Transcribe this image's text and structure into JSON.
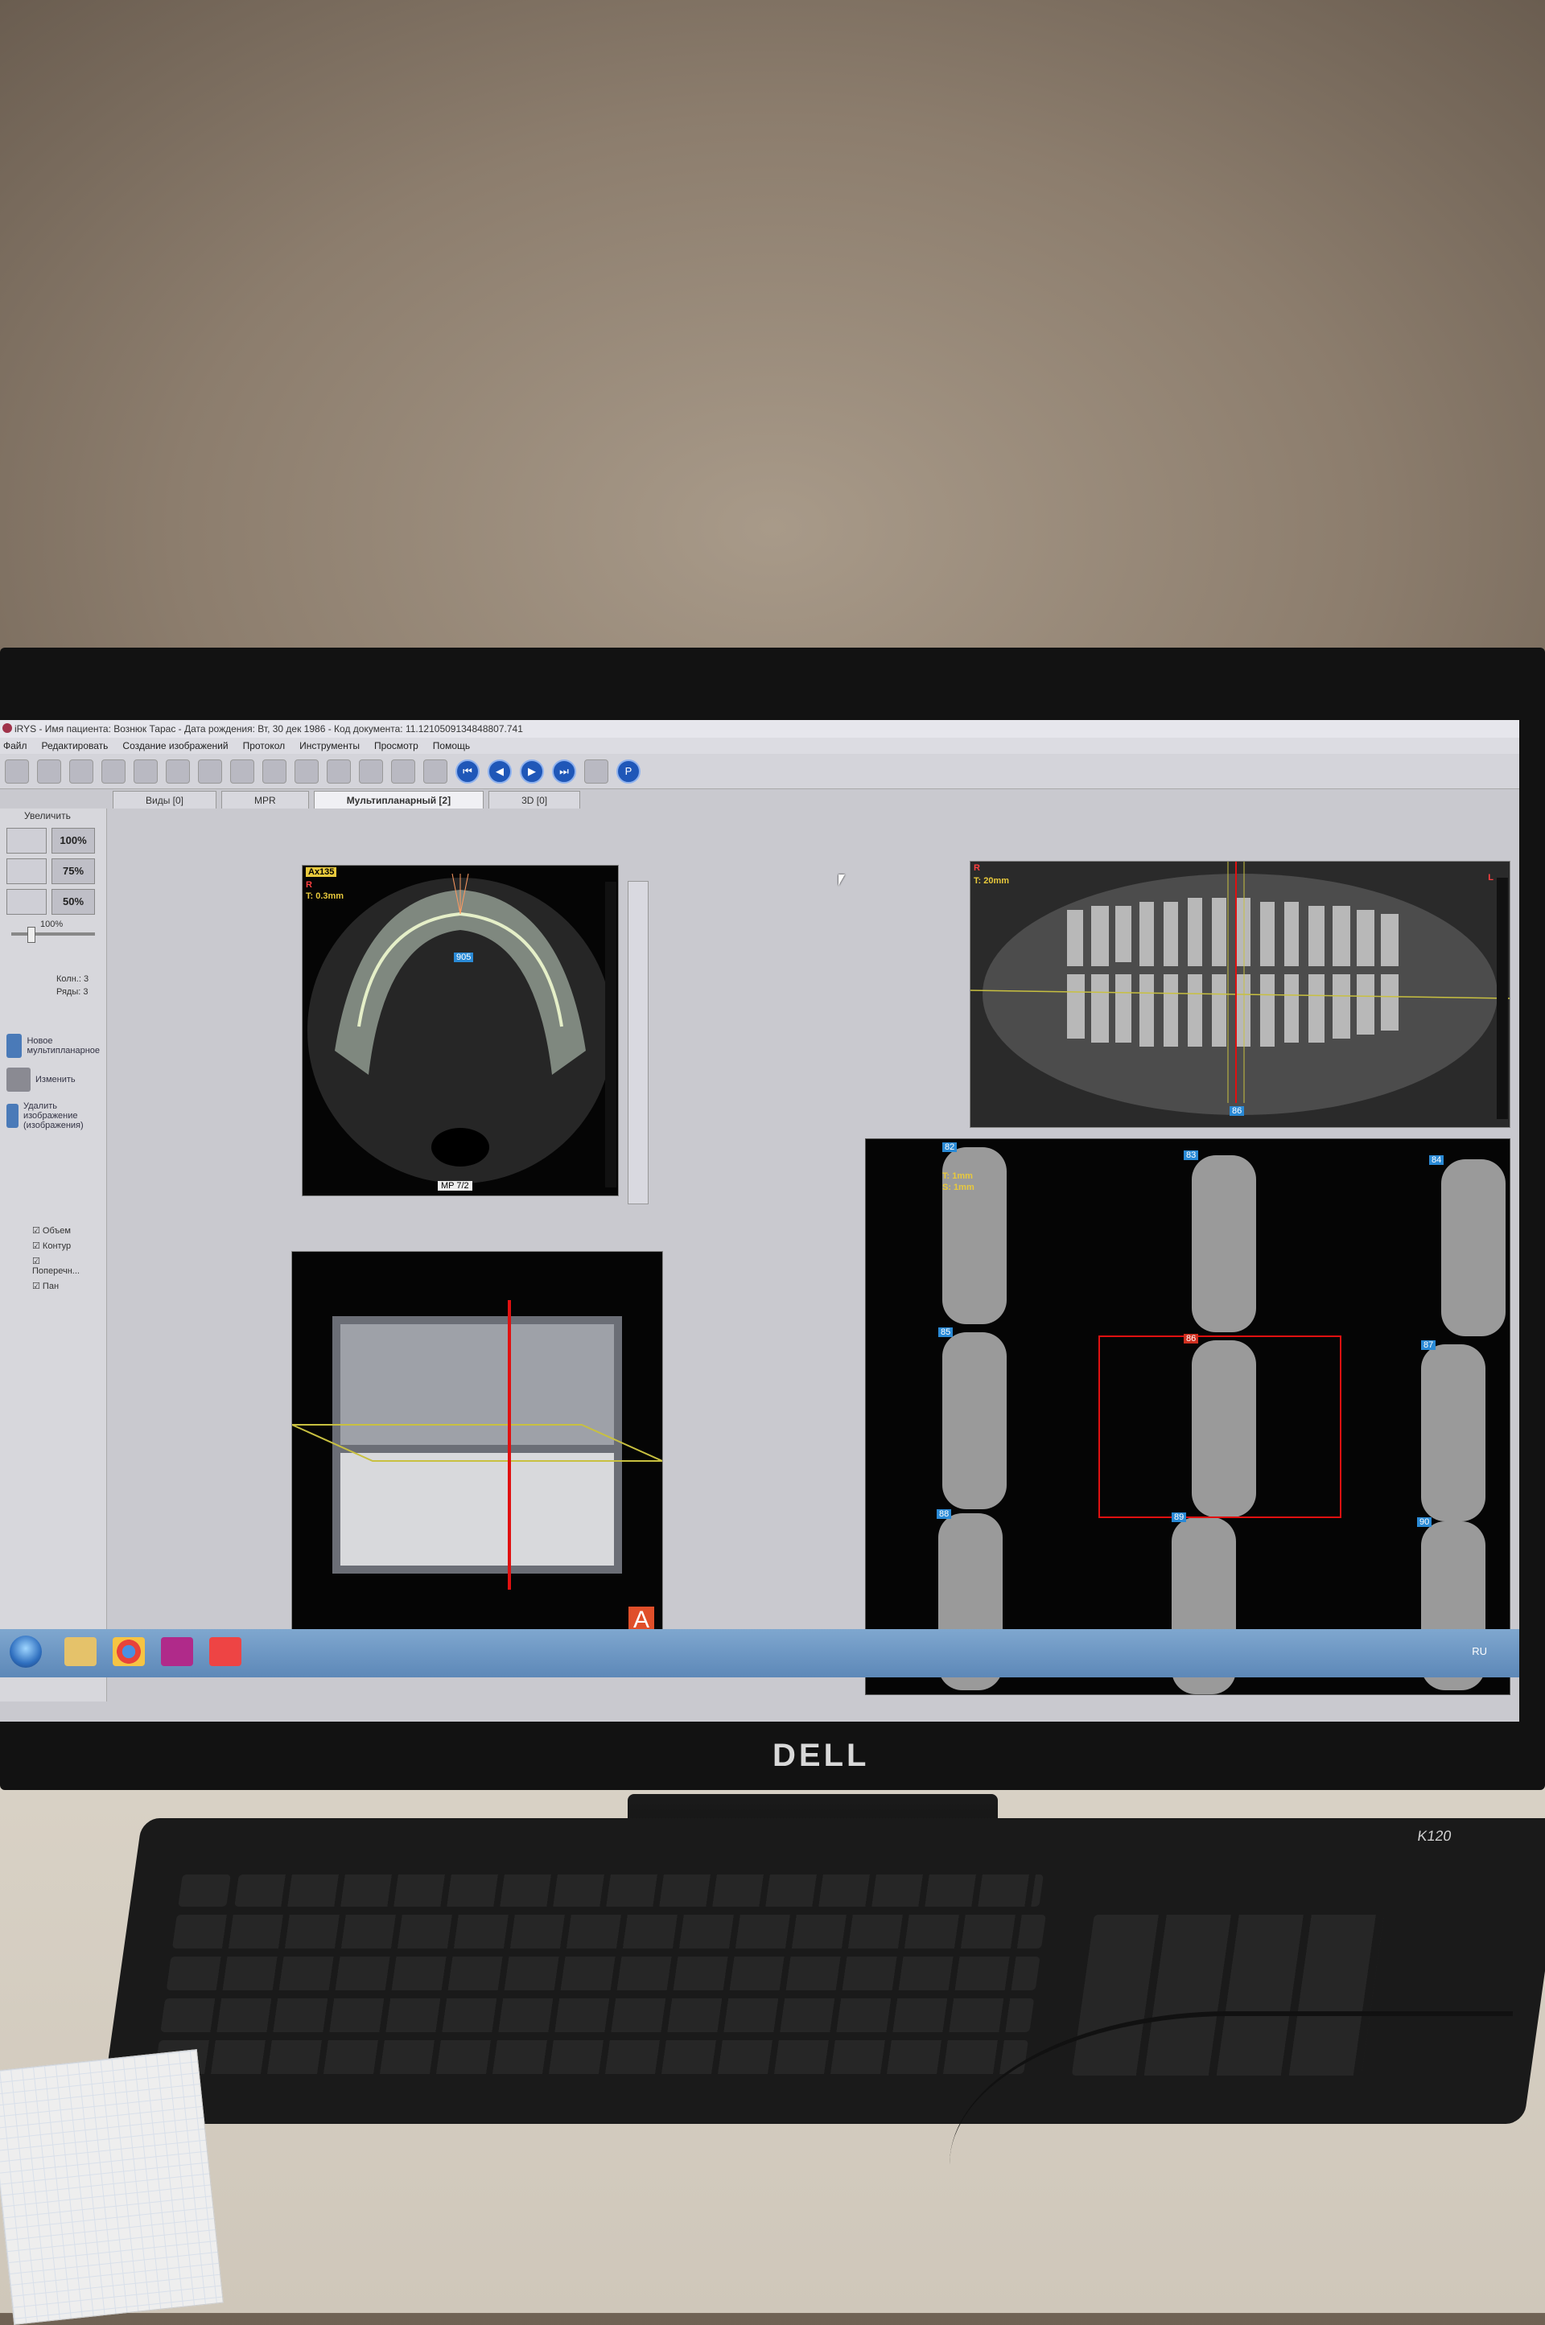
{
  "window": {
    "title": "iRYS - Имя пациента: Вознюк  Тарас  - Дата рождения: Вт, 30 дек 1986 - Код документа: 11.1210509134848807.741"
  },
  "menu": [
    "Файл",
    "Редактировать",
    "Создание изображений",
    "Протокол",
    "Инструменты",
    "Просмотр",
    "Помощь"
  ],
  "tabs": [
    "Виды [0]",
    "MPR",
    "Мультипланарный [2]",
    "3D [0]"
  ],
  "left_panel": {
    "zoom_header": "Увеличить",
    "zoom_buttons": [
      "100%",
      "75%",
      "50%"
    ],
    "slider_value": "100%",
    "columns_label": "Колн.: 3",
    "rows_label": "Ряды: 3",
    "new_button": "Новое мультипланарное",
    "edit_button": "Изменить",
    "delete_button": "Удалить изображение (изображения)",
    "checkboxes": [
      "Объем",
      "Контур",
      "Поперечн...",
      "Пан"
    ]
  },
  "axial": {
    "tag": "Ax135",
    "side": "R",
    "thickness": "T: 0.3mm",
    "marker": "905",
    "footer": "MP 7/2"
  },
  "panoramic": {
    "side_left": "R",
    "side_right": "L",
    "thickness": "T: 20mm",
    "marker": "86"
  },
  "cross_sections": {
    "first_thickness": "T: 1mm",
    "first_spacing": "S: 1mm",
    "tags": [
      "82",
      "83",
      "84",
      "85",
      "86",
      "87",
      "88",
      "89",
      "90"
    ]
  },
  "volume": {
    "orientation_badge": "A"
  },
  "taskbar": {
    "language": "RU"
  },
  "hardware": {
    "brand": "DELL",
    "keyboard_model": "K120"
  }
}
